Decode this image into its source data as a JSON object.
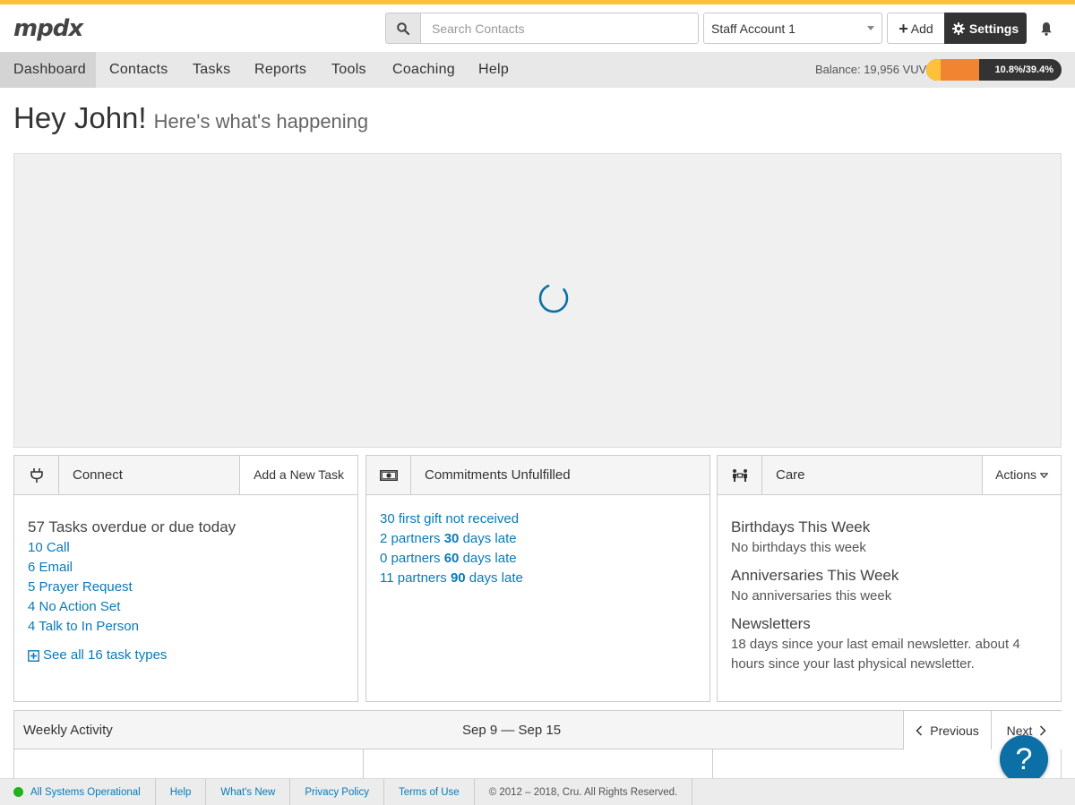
{
  "brand": {
    "logo_text": "mpdx"
  },
  "header": {
    "search": {
      "placeholder": "Search Contacts",
      "value": ""
    },
    "account": {
      "selected": "Staff Account 1"
    },
    "add_label": "Add",
    "settings_label": "Settings"
  },
  "nav": {
    "items": [
      {
        "label": "Dashboard",
        "active": true
      },
      {
        "label": "Contacts"
      },
      {
        "label": "Tasks"
      },
      {
        "label": "Reports"
      },
      {
        "label": "Tools"
      },
      {
        "label": "Coaching"
      },
      {
        "label": "Help"
      }
    ],
    "balance": "Balance: 19,956 VUV",
    "progress": {
      "received_percent": 10.8,
      "pledged_percent": 39.4,
      "label": "10.8%/39.4%"
    }
  },
  "greeting": {
    "title": "Hey John!",
    "subtitle": "Here's what's happening"
  },
  "connect": {
    "title": "Connect",
    "action": "Add a New Task",
    "summary": "57 Tasks overdue or due today",
    "tasks": [
      "10 Call",
      "6 Email",
      "5 Prayer Request",
      "4 No Action Set",
      "4 Talk to In Person"
    ],
    "see_all": "See all 16 task types"
  },
  "commitments": {
    "title": "Commitments Unfulfilled",
    "first_gift": "30 first gift not received",
    "late": [
      {
        "prefix": "2 partners ",
        "days": "30",
        "suffix": " days late"
      },
      {
        "prefix": "0 partners ",
        "days": "60",
        "suffix": " days late"
      },
      {
        "prefix": "11 partners ",
        "days": "90",
        "suffix": " days late"
      }
    ]
  },
  "care": {
    "title": "Care",
    "action": "Actions",
    "birthdays_heading": "Birthdays This Week",
    "birthdays_text": "No birthdays this week",
    "anniversaries_heading": "Anniversaries This Week",
    "anniversaries_text": "No anniversaries this week",
    "newsletters_heading": "Newsletters",
    "newsletters_text": "18 days since your last email newsletter. about 4 hours since your last physical newsletter."
  },
  "weekly": {
    "title": "Weekly Activity",
    "range": "Sep 9 — Sep 15",
    "previous": "Previous",
    "next": "Next"
  },
  "footer": {
    "status": "All Systems Operational",
    "links": [
      "Help",
      "What's New",
      "Privacy Policy",
      "Terms of Use"
    ],
    "copyright": "© 2012 – 2018, Cru. All Rights Reserved."
  },
  "colors": {
    "accent_yellow": "#fdc13a",
    "accent_orange": "#f08431",
    "link_blue": "#0a7ab7",
    "help_button": "#0c6fa5",
    "status_green": "#1fb31f"
  }
}
